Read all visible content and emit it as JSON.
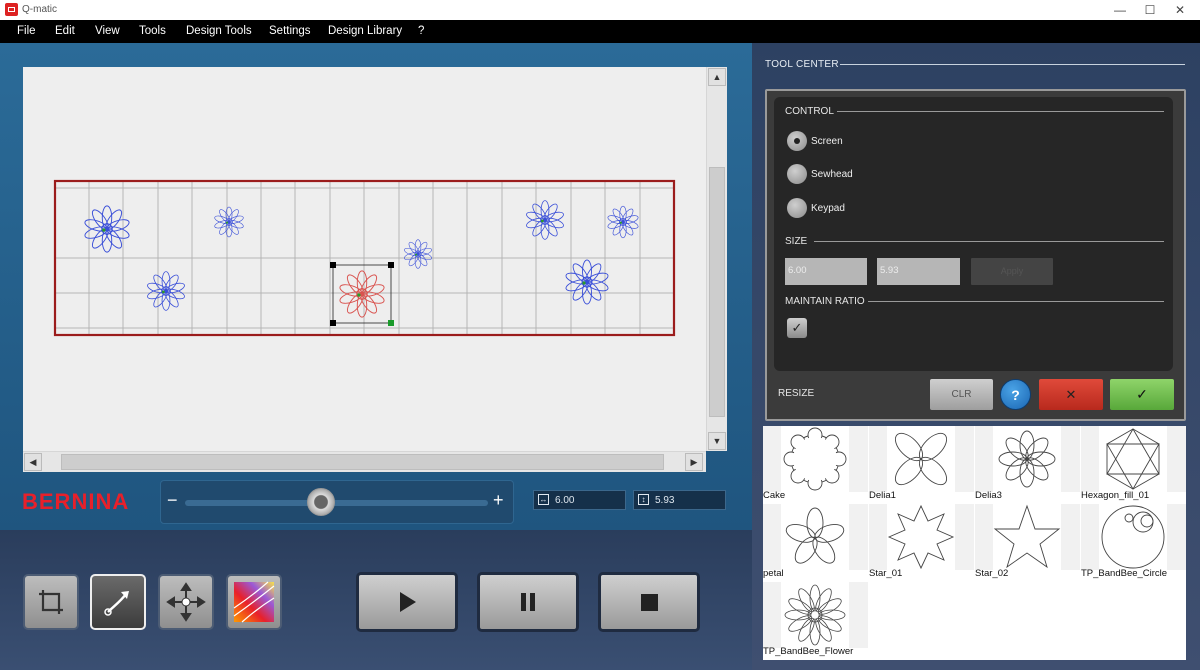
{
  "window": {
    "title": "Q-matic"
  },
  "menu": [
    "File",
    "Edit",
    "View",
    "Tools",
    "Design Tools",
    "Settings",
    "Design Library",
    "?"
  ],
  "brand": "BERNINA",
  "zoom": {
    "minus": "−",
    "plus": "+"
  },
  "dimensions": {
    "width": "6.00",
    "height": "5.93"
  },
  "tool_center": {
    "title": "TOOL CENTER",
    "control_label": "CONTROL",
    "options": [
      "Screen",
      "Sewhead",
      "Keypad"
    ],
    "selected_option": "Screen",
    "size_label": "SIZE",
    "size_width": "6.00",
    "size_height": "5.93",
    "apply_label": "Apply",
    "maintain_ratio_label": "MAINTAIN RATIO",
    "maintain_ratio_checked": true,
    "resize_label": "RESIZE",
    "clr_label": "CLR",
    "help_label": "?",
    "cancel_label": "✕",
    "ok_label": "✓"
  },
  "library": [
    {
      "name": "Cake",
      "icon": "scalloped-circle"
    },
    {
      "name": "Delia1",
      "icon": "four-petal-flower"
    },
    {
      "name": "Delia3",
      "icon": "eight-petal-flower"
    },
    {
      "name": "Hexagon_fill_01",
      "icon": "hexagon-star"
    },
    {
      "name": "petal",
      "icon": "five-petal-flower"
    },
    {
      "name": "Star_01",
      "icon": "eight-point-star"
    },
    {
      "name": "Star_02",
      "icon": "five-point-star"
    },
    {
      "name": "TP_BandBee_Circle",
      "icon": "circles"
    },
    {
      "name": "TP_BandBee_Flower",
      "icon": "daisy-flower"
    }
  ],
  "colors": {
    "accent_red": "#e8202a",
    "quilt_border": "#9b1c1c",
    "motif": "#3a4fd8",
    "selected_motif": "#d9534f"
  }
}
